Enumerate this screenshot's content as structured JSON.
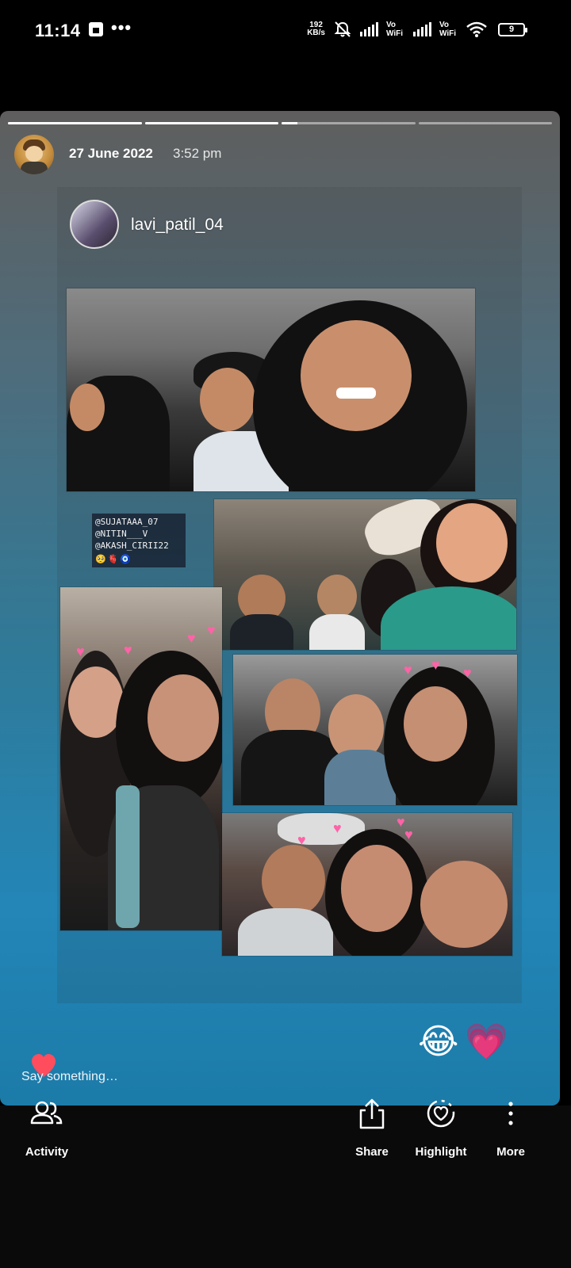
{
  "status_bar": {
    "time": "11:14",
    "dots": "•••",
    "net_speed_value": "192",
    "net_speed_unit": "KB/s",
    "vo_wifi_1": "Vo WiFi",
    "vo_wifi_2": "Vo WiFi",
    "battery": "9"
  },
  "story": {
    "segments": [
      1,
      1,
      0.12,
      0
    ],
    "date": "27 June 2022",
    "time": "3:52 pm",
    "shared_post": {
      "username": "lavi_patil_04",
      "tags": [
        "@SUJATAAA_07",
        "@NITIN___V",
        "@AKASH_CIRII22"
      ]
    },
    "stickers": [
      "😂",
      "💗"
    ],
    "reply_placeholder": "Say something…"
  },
  "bottom_bar": {
    "activity": "Activity",
    "share": "Share",
    "highlight": "Highlight",
    "more": "More"
  },
  "colors": {
    "background": "#000000",
    "heart": "#ff4d5e",
    "sticker_pink": "#ff63a7"
  }
}
